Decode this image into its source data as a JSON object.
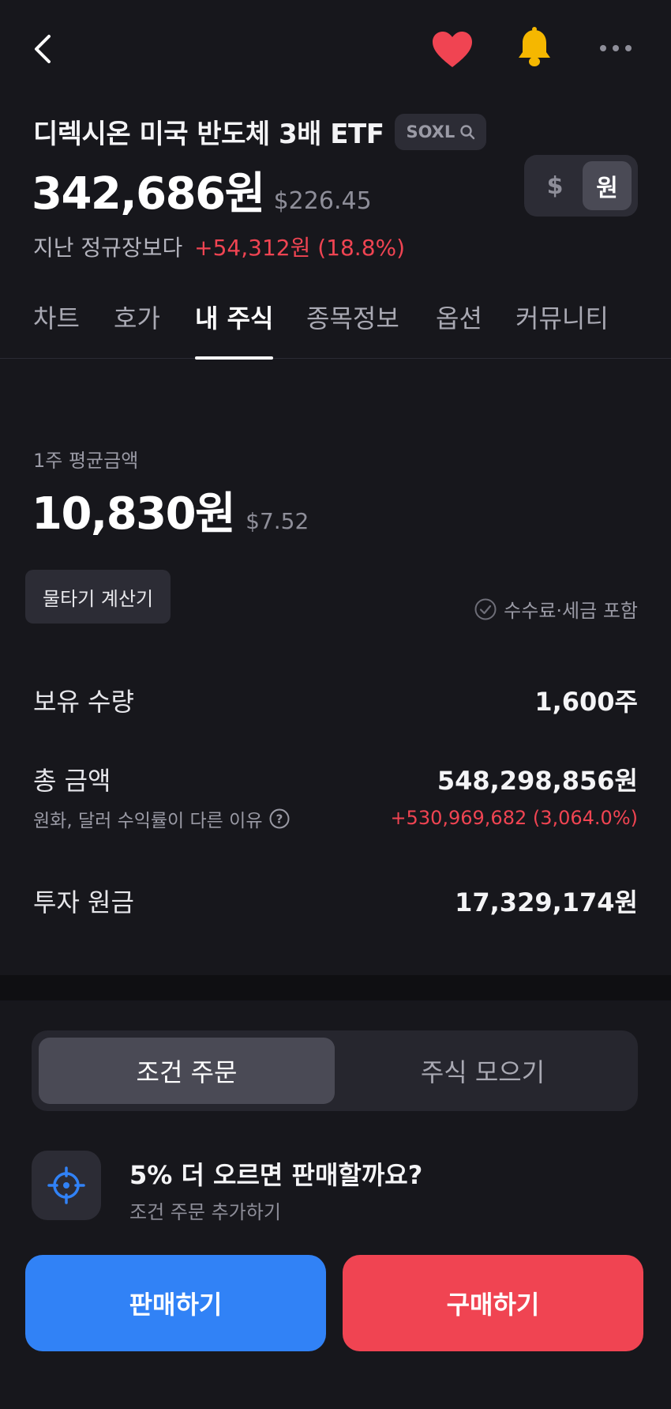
{
  "colors": {
    "background": "#17171c",
    "up": "#f04452",
    "sell_blue": "#3182f6",
    "heart": "#f04452",
    "bell": "#f5b700"
  },
  "topbar": {
    "icons": [
      "back-icon",
      "heart-icon",
      "bell-icon",
      "more-icon"
    ]
  },
  "header": {
    "name": "디렉시온 미국 반도체 3배 ETF",
    "ticker": "SOXL",
    "price_krw": "342,686원",
    "price_usd": "$226.45",
    "change_label": "지난 정규장보다",
    "change_value": "+54,312원 (18.8%)",
    "currency_options": [
      "$",
      "원"
    ],
    "currency_selected": "원"
  },
  "tabs": [
    {
      "label": "차트"
    },
    {
      "label": "호가"
    },
    {
      "label": "내 주식",
      "active": true
    },
    {
      "label": "종목정보"
    },
    {
      "label": "옵션"
    },
    {
      "label": "커뮤니티"
    }
  ],
  "my_stock": {
    "avg_label": "1주 평균금액",
    "avg_krw": "10,830원",
    "avg_usd": "$7.52",
    "calc_button": "물타기 계산기",
    "fee_note": "수수료·세금 포함",
    "quantity_label": "보유 수량",
    "quantity_value": "1,600주",
    "total_label": "총 금액",
    "total_value": "548,298,856원",
    "total_sub": "원화, 달러 수익률이 다른 이유",
    "total_profit": "+530,969,682 (3,064.0%)",
    "principal_label": "투자 원금",
    "principal_value": "17,329,174원"
  },
  "bottom": {
    "segments": [
      "조건 주문",
      "주식 모으기"
    ],
    "segment_selected": "조건 주문",
    "cond_title": "5% 더 오르면 판매할까요?",
    "cond_sub": "조건 주문 추가하기",
    "sell_label": "판매하기",
    "buy_label": "구매하기"
  }
}
